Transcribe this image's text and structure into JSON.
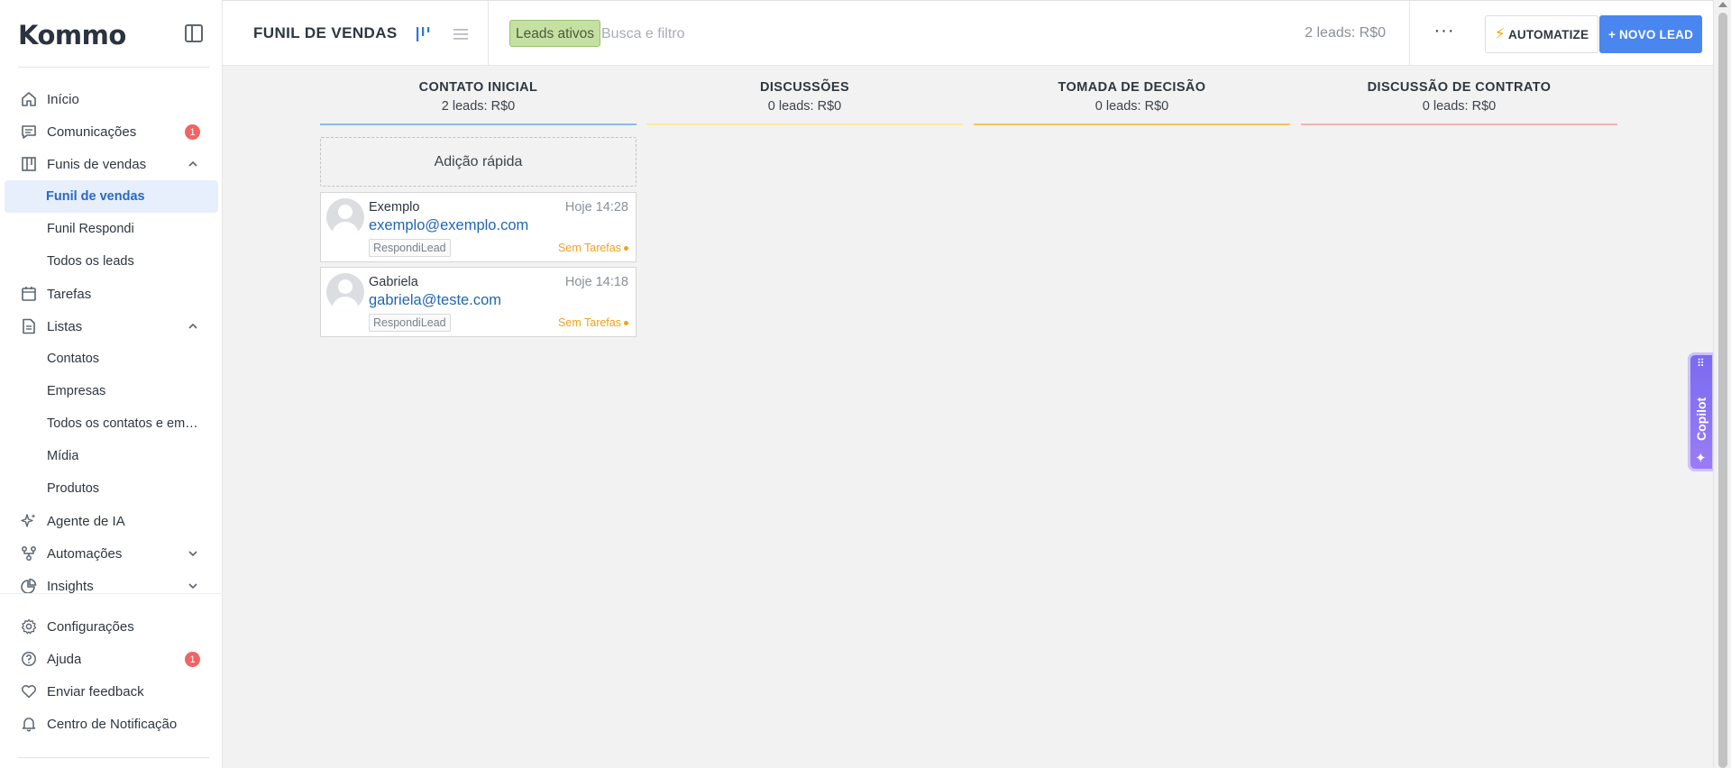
{
  "brand": {
    "logo": "Kommo"
  },
  "sidebar": {
    "items": [
      {
        "label": "Início",
        "icon": "home-icon"
      },
      {
        "label": "Comunicações",
        "icon": "chat-icon",
        "badge": "1"
      },
      {
        "label": "Funis de vendas",
        "icon": "funnel-board-icon",
        "expanded": true
      },
      {
        "label": "Funil de vendas",
        "sub": true,
        "active": true
      },
      {
        "label": "Funil Respondi",
        "sub": true
      },
      {
        "label": "Todos os leads",
        "sub": true
      },
      {
        "label": "Tarefas",
        "icon": "calendar-icon"
      },
      {
        "label": "Listas",
        "icon": "document-icon",
        "expanded": true
      },
      {
        "label": "Contatos",
        "sub": true
      },
      {
        "label": "Empresas",
        "sub": true
      },
      {
        "label": "Todos os contatos e empresas",
        "sub": true
      },
      {
        "label": "Mídia",
        "sub": true
      },
      {
        "label": "Produtos",
        "sub": true
      },
      {
        "label": "Agente de IA",
        "icon": "sparkles-icon"
      },
      {
        "label": "Automações",
        "icon": "automation-icon",
        "expanded": false
      },
      {
        "label": "Insights",
        "icon": "pie-chart-icon",
        "expanded": false
      }
    ],
    "bottom_items": [
      {
        "label": "Configurações",
        "icon": "gear-icon"
      },
      {
        "label": "Ajuda",
        "icon": "help-icon",
        "badge": "1"
      },
      {
        "label": "Enviar feedback",
        "icon": "heart-icon"
      },
      {
        "label": "Centro de Notificação",
        "icon": "bell-icon"
      }
    ]
  },
  "topbar": {
    "title": "FUNIL DE VENDAS",
    "filter_tag": "Leads ativos",
    "search_placeholder": "Busca e filtro",
    "summary": "2 leads: R$0",
    "more": "···",
    "automate_label": "AUTOMATIZE",
    "new_lead_label": "+ NOVO LEAD"
  },
  "board": {
    "quick_add": "Adição rápida",
    "columns": [
      {
        "title": "CONTATO INICIAL",
        "summary": "2 leads: R$0",
        "color": "#8ab8ef"
      },
      {
        "title": "DISCUSSÕES",
        "summary": "0 leads: R$0",
        "color": "#fde9a6"
      },
      {
        "title": "TOMADA DE DECISÃO",
        "summary": "0 leads: R$0",
        "color": "#f6c35d"
      },
      {
        "title": "DISCUSSÃO DE CONTRATO",
        "summary": "0 leads: R$0",
        "color": "#f6b3b3"
      }
    ],
    "leads": [
      {
        "name": "Exemplo",
        "time": "Hoje 14:28",
        "email": "exemplo@exemplo.com",
        "tag": "RespondiLead",
        "tasks": "Sem Tarefas"
      },
      {
        "name": "Gabriela",
        "time": "Hoje 14:18",
        "email": "gabriela@teste.com",
        "tag": "RespondiLead",
        "tasks": "Sem Tarefas"
      }
    ]
  },
  "copilot": {
    "label": "Copilot"
  }
}
